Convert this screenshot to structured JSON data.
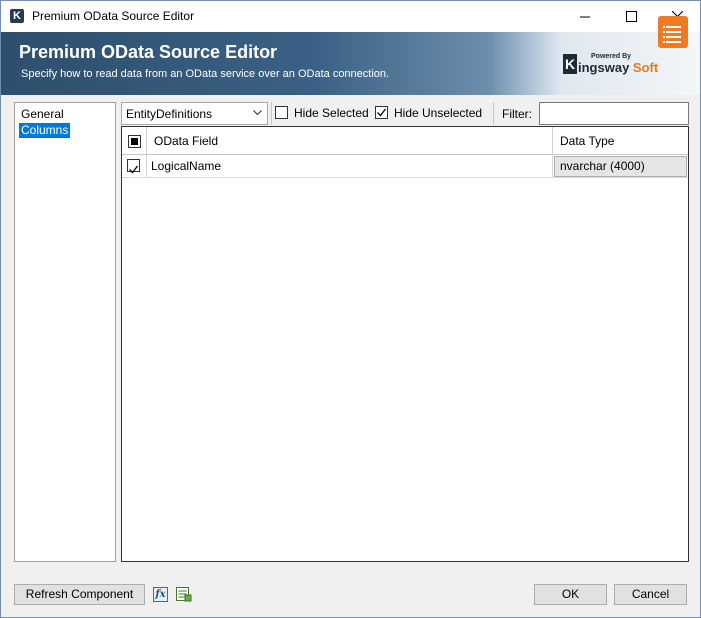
{
  "window": {
    "title": "Premium OData Source Editor",
    "app_icon_letter": "K"
  },
  "banner": {
    "title": "Premium OData Source Editor",
    "subtitle": "Specify how to read data from an OData service over an OData connection.",
    "logo": {
      "powered": "Powered By",
      "k": "K",
      "name_part1": "ingsway",
      "name_part2": "Soft"
    }
  },
  "nav": {
    "items": [
      {
        "label": "General",
        "selected": false
      },
      {
        "label": "Columns",
        "selected": true
      }
    ]
  },
  "toolbar": {
    "entity_select": "EntityDefinitions",
    "hide_selected": {
      "label": "Hide Selected",
      "checked": false
    },
    "hide_unselected": {
      "label": "Hide Unselected",
      "checked": true
    },
    "filter_label": "Filter:",
    "filter_value": ""
  },
  "grid": {
    "columns": [
      "OData Field",
      "Data Type"
    ],
    "rows": [
      {
        "checked": true,
        "field": "LogicalName",
        "type": "nvarchar (4000)"
      }
    ]
  },
  "footer": {
    "refresh_label": "Refresh Component",
    "fx_label": "fx",
    "ok_label": "OK",
    "cancel_label": "Cancel"
  },
  "colors": {
    "accent": "#0078d7",
    "banner_dark": "#2e4f6d",
    "brand_orange": "#f17b22"
  }
}
